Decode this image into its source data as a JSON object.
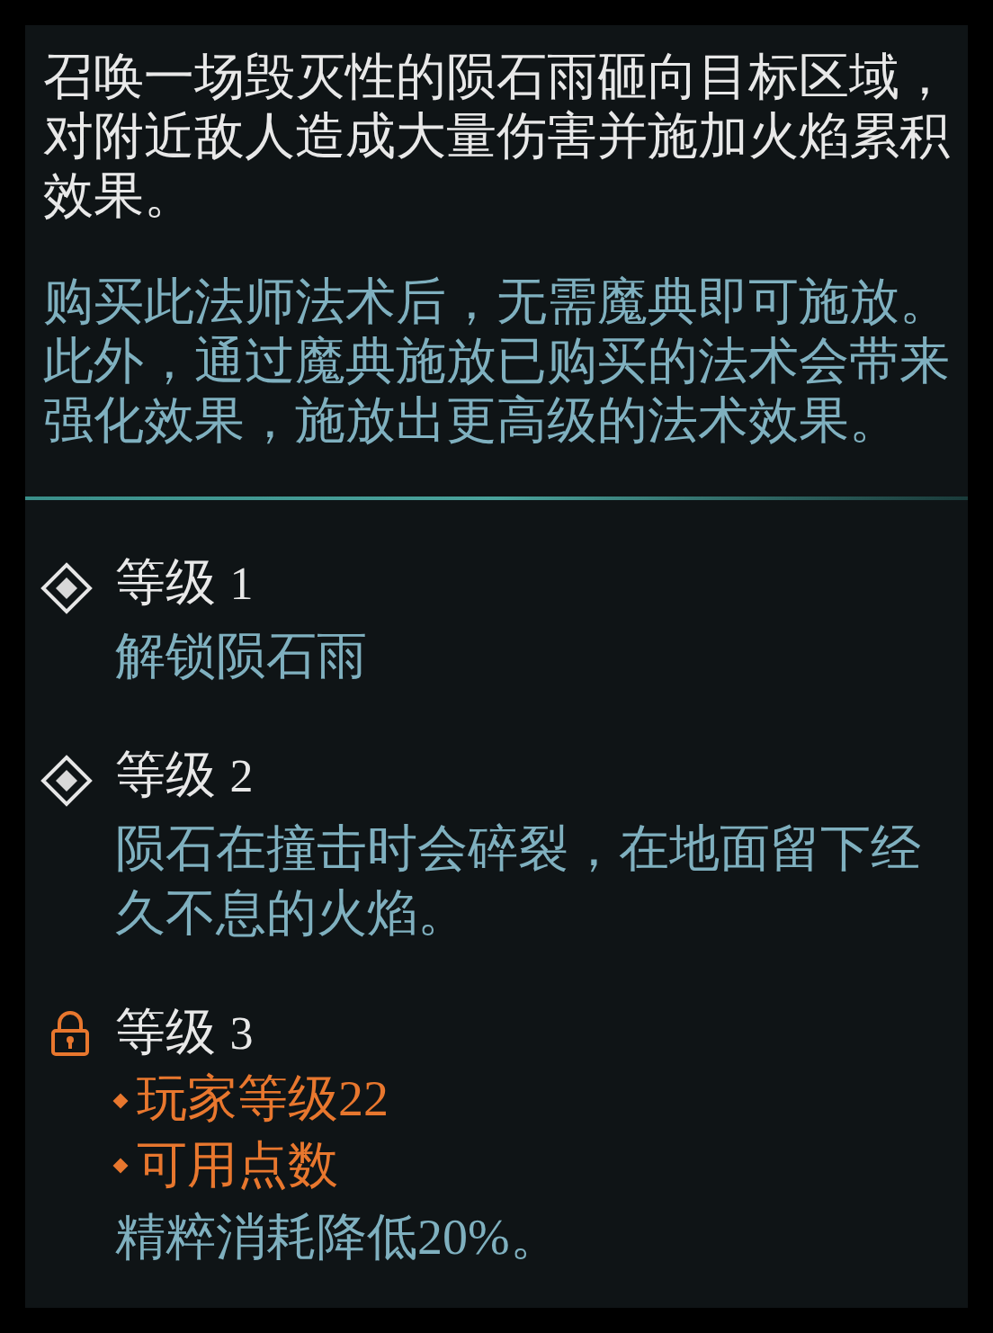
{
  "description": "召唤一场毁灭性的陨石雨砸向目标区域，对附近敌人造成大量伤害并施加火焰累积效果。",
  "note": "购买此法师法术后，无需魔典即可施放。此外，通过魔典施放已购买的法术会带来强化效果，施放出更高级的法术效果。",
  "levels": [
    {
      "label": "等级",
      "number": "1",
      "locked": false,
      "description": "解锁陨石雨"
    },
    {
      "label": "等级",
      "number": "2",
      "locked": false,
      "description": "陨石在撞击时会碎裂，在地面留下经久不息的火焰。"
    },
    {
      "label": "等级",
      "number": "3",
      "locked": true,
      "requirements": [
        "玩家等级22",
        "可用点数"
      ],
      "description": "精粹消耗降低20%。"
    }
  ]
}
